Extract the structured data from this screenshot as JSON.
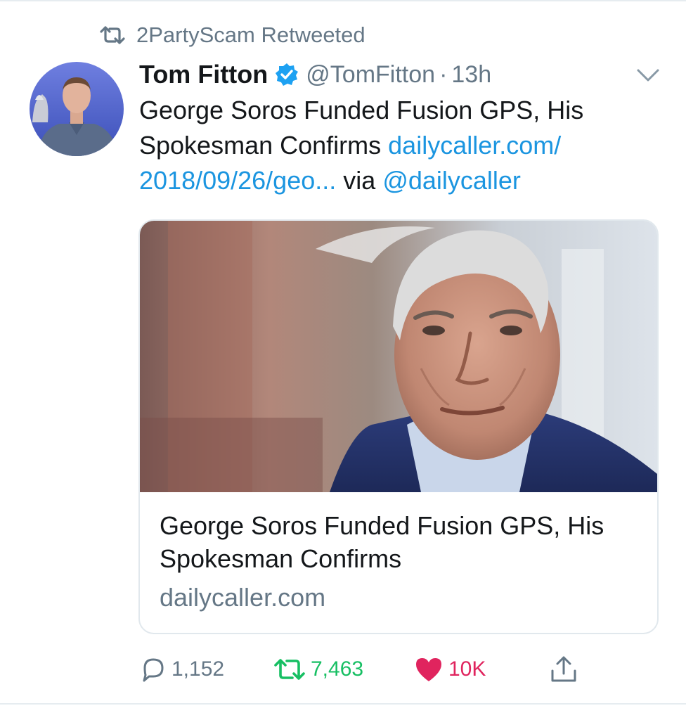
{
  "retweet": {
    "icon": "retweet-icon",
    "text": "2PartyScam Retweeted"
  },
  "author": {
    "name": "Tom Fitton",
    "verified": true,
    "handle": "@TomFitton",
    "separator": "·",
    "time": "13h"
  },
  "tweet": {
    "text": "George Soros Funded Fusion GPS, His Spokesman Confirms",
    "link": "dailycaller.com/ 2018/09/26/geo...",
    "via": "via",
    "mention": "@dailycaller"
  },
  "card": {
    "title": "George Soros Funded Fusion GPS, His Spokesman Confirms",
    "domain": "dailycaller.com"
  },
  "actions": {
    "reply_count": "1,152",
    "retweet_count": "7,463",
    "like_count": "10K"
  },
  "colors": {
    "link": "#1b95e0",
    "secondary": "#657786",
    "retweet_active": "#17bf63",
    "like_active": "#e0245e",
    "verified": "#1da1f2"
  }
}
